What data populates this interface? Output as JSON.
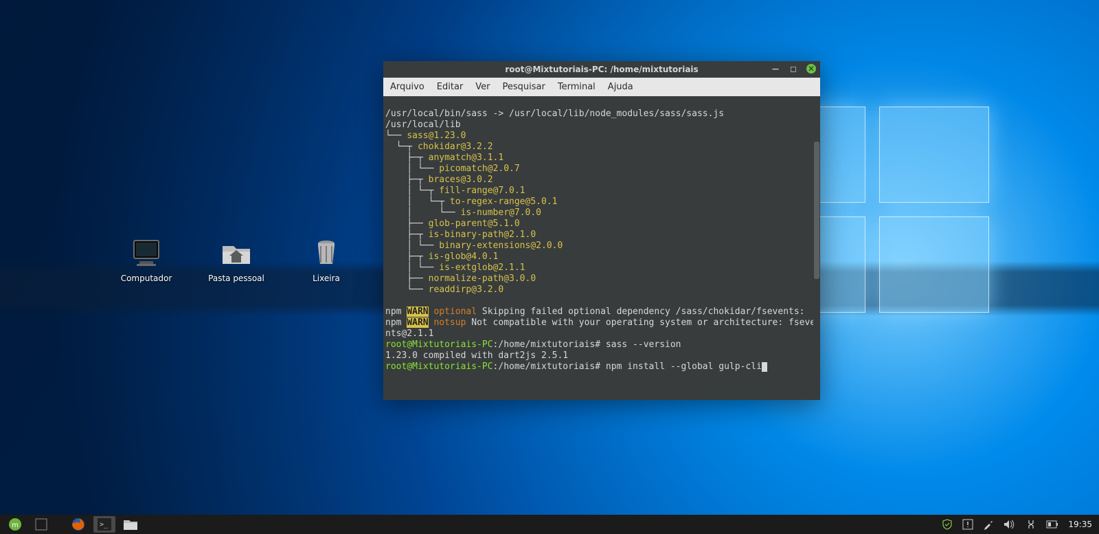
{
  "desktop": {
    "icons": [
      {
        "label": "Computador"
      },
      {
        "label": "Pasta pessoal"
      },
      {
        "label": "Lixeira"
      }
    ]
  },
  "terminal": {
    "title": "root@Mixtutoriais-PC: /home/mixtutoriais",
    "menu": [
      "Arquivo",
      "Editar",
      "Ver",
      "Pesquisar",
      "Terminal",
      "Ajuda"
    ],
    "line_symlink": "/usr/local/bin/sass -> /usr/local/lib/node_modules/sass/sass.js",
    "line_lib": "/usr/local/lib",
    "tree": [
      {
        "prefix": "└── ",
        "pkg": "sass@1.23.0"
      },
      {
        "prefix": "  └─┬ ",
        "pkg": "chokidar@3.2.2"
      },
      {
        "prefix": "    ├─┬ ",
        "pkg": "anymatch@3.1.1"
      },
      {
        "prefix": "    │ └── ",
        "pkg": "picomatch@2.0.7"
      },
      {
        "prefix": "    ├─┬ ",
        "pkg": "braces@3.0.2"
      },
      {
        "prefix": "    │ └─┬ ",
        "pkg": "fill-range@7.0.1"
      },
      {
        "prefix": "    │   └─┬ ",
        "pkg": "to-regex-range@5.0.1"
      },
      {
        "prefix": "    │     └── ",
        "pkg": "is-number@7.0.0"
      },
      {
        "prefix": "    ├── ",
        "pkg": "glob-parent@5.1.0"
      },
      {
        "prefix": "    ├─┬ ",
        "pkg": "is-binary-path@2.1.0"
      },
      {
        "prefix": "    │ └── ",
        "pkg": "binary-extensions@2.0.0"
      },
      {
        "prefix": "    ├─┬ ",
        "pkg": "is-glob@4.0.1"
      },
      {
        "prefix": "    │ └── ",
        "pkg": "is-extglob@2.1.1"
      },
      {
        "prefix": "    ├── ",
        "pkg": "normalize-path@3.0.0"
      },
      {
        "prefix": "    └── ",
        "pkg": "readdirp@3.2.0"
      }
    ],
    "warn1": {
      "npm": "npm ",
      "warn": "WARN",
      "tag": " optional",
      "msg": " Skipping failed optional dependency /sass/chokidar/fsevents:"
    },
    "warn2": {
      "npm": "npm ",
      "warn": "WARN",
      "tag": " notsup",
      "msg": " Not compatible with your operating system or architecture: fseve"
    },
    "warn2b": "nts@2.1.1",
    "prompt1": {
      "user": "root@Mixtutoriais-PC",
      "path": ":/home/mixtutoriais",
      "hash": "# ",
      "cmd": "sass --version"
    },
    "ver": "1.23.0 compiled with dart2js 2.5.1",
    "prompt2": {
      "user": "root@Mixtutoriais-PC",
      "path": ":/home/mixtutoriais",
      "hash": "# ",
      "cmd": "npm install --global gulp-cli"
    }
  },
  "taskbar": {
    "clock": "19:35"
  }
}
